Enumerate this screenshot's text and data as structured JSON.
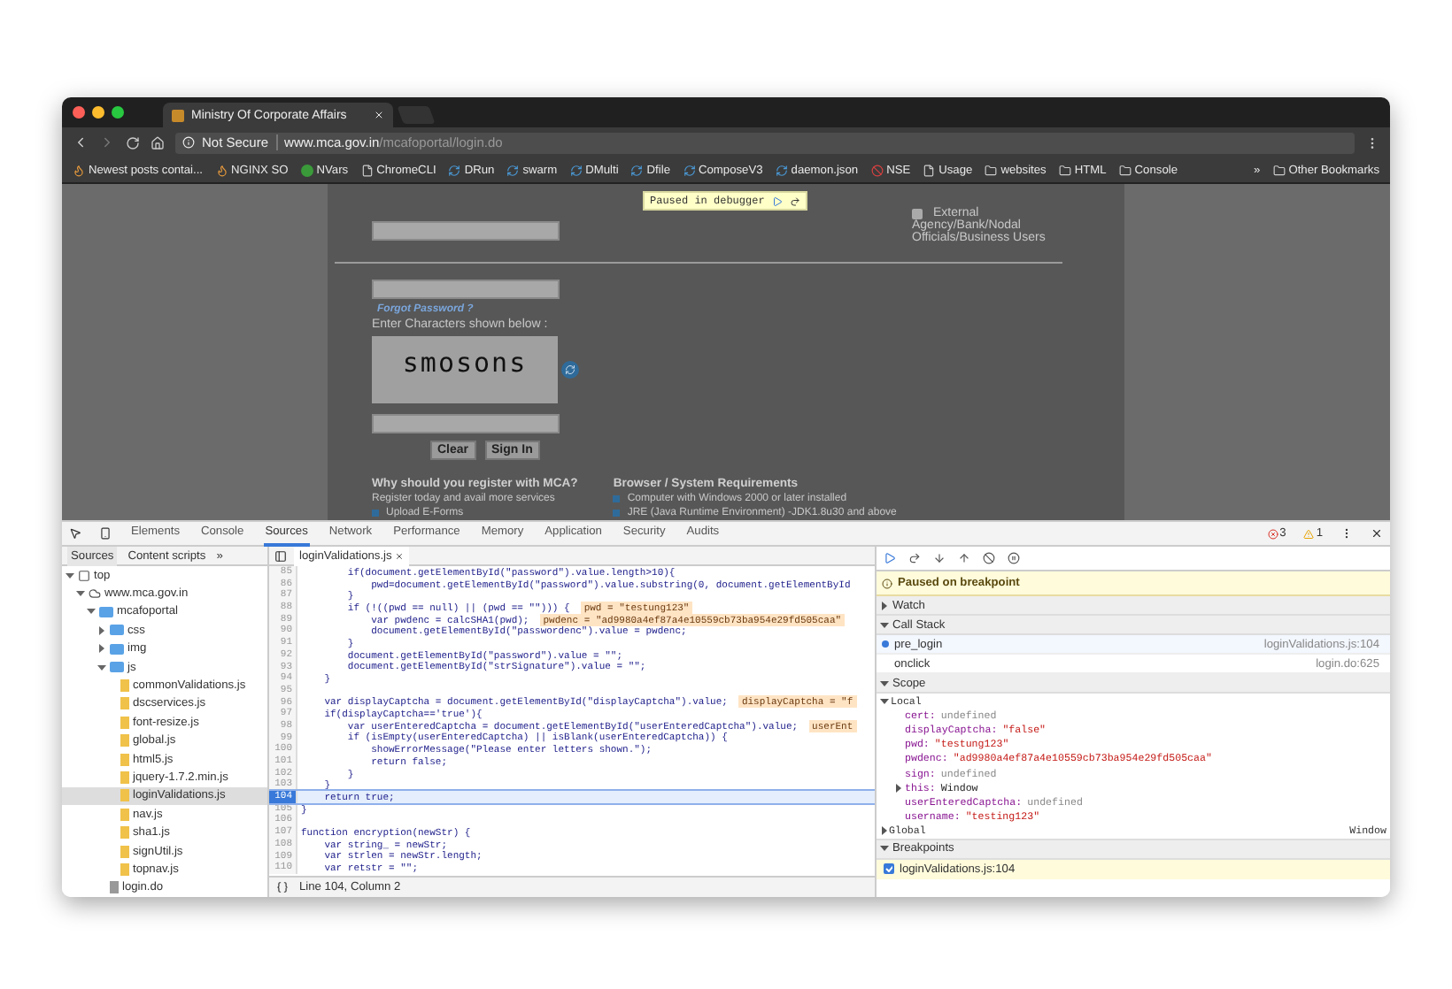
{
  "browser": {
    "tabs": [
      {
        "title": "Ministry Of Corporate Affairs",
        "selected": true
      }
    ],
    "address": {
      "security": "Not Secure",
      "host": "www.mca.gov.in",
      "path": "/mcafoportal/login.do"
    },
    "bookmarks": [
      {
        "label": "Newest posts contai...",
        "kind": "flame"
      },
      {
        "label": "NGINX SO",
        "kind": "flame"
      },
      {
        "label": "NVars",
        "kind": "dot"
      },
      {
        "label": "ChromeCLI",
        "kind": "page"
      },
      {
        "label": "DRun",
        "kind": "swirl"
      },
      {
        "label": "swarm",
        "kind": "swirl"
      },
      {
        "label": "DMulti",
        "kind": "swirl"
      },
      {
        "label": "Dfile",
        "kind": "swirl"
      },
      {
        "label": "ComposeV3",
        "kind": "swirl"
      },
      {
        "label": "daemon.json",
        "kind": "swirl"
      },
      {
        "label": "NSE",
        "kind": "badge"
      },
      {
        "label": "Usage",
        "kind": "page"
      },
      {
        "label": "websites",
        "kind": "folder"
      },
      {
        "label": "HTML",
        "kind": "folder"
      },
      {
        "label": "Console",
        "kind": "folder"
      }
    ],
    "overflow": "»",
    "other_bookmarks": "Other Bookmarks"
  },
  "page": {
    "paused_banner": "Paused in debugger",
    "external": {
      "label": "External",
      "checked": false,
      "description": "Agency/Bank/Nodal Officials/Business Users"
    },
    "forgot_link": "Forgot Password ?",
    "captcha_prompt": "Enter Characters shown below :",
    "captcha_text": "smosons",
    "buttons": [
      "Clear",
      "Sign In"
    ],
    "why": {
      "heading": "Why should you register with MCA?",
      "text": "Register today and avail more services",
      "items": [
        "Upload E-Forms"
      ]
    },
    "requirements": {
      "heading": "Browser / System Requirements",
      "items": [
        "Computer with Windows 2000 or later installed",
        "JRE (Java Runtime Environment) -JDK1.8u30 and above"
      ]
    }
  },
  "devtools": {
    "tabs": [
      {
        "label": "Elements",
        "selected": false
      },
      {
        "label": "Console",
        "selected": false
      },
      {
        "label": "Sources",
        "selected": true
      },
      {
        "label": "Network",
        "selected": false
      },
      {
        "label": "Performance",
        "selected": false
      },
      {
        "label": "Memory",
        "selected": false
      },
      {
        "label": "Application",
        "selected": false
      },
      {
        "label": "Security",
        "selected": false
      },
      {
        "label": "Audits",
        "selected": false
      }
    ],
    "errors": "3",
    "warnings": "1",
    "navigator": {
      "tabs": [
        {
          "label": "Sources",
          "selected": true
        },
        {
          "label": "Content scripts",
          "selected": false
        }
      ],
      "more": "»",
      "tree": [
        {
          "label": "top",
          "kind": "frame",
          "expanded": true,
          "selected": false,
          "children": [
            {
              "label": "www.mca.gov.in",
              "kind": "domain",
              "expanded": true,
              "selected": false,
              "children": [
                {
                  "label": "mcafoportal",
                  "kind": "folder",
                  "expanded": true,
                  "selected": false,
                  "children": [
                    {
                      "label": "css",
                      "kind": "folder",
                      "expanded": false,
                      "selected": false
                    },
                    {
                      "label": "img",
                      "kind": "folder",
                      "expanded": false,
                      "selected": false
                    },
                    {
                      "label": "js",
                      "kind": "folder",
                      "expanded": true,
                      "selected": false,
                      "children": [
                        {
                          "label": "commonValidations.js",
                          "kind": "script",
                          "selected": false
                        },
                        {
                          "label": "dscservices.js",
                          "kind": "script",
                          "selected": false
                        },
                        {
                          "label": "font-resize.js",
                          "kind": "script",
                          "selected": false
                        },
                        {
                          "label": "global.js",
                          "kind": "script",
                          "selected": false
                        },
                        {
                          "label": "html5.js",
                          "kind": "script",
                          "selected": false
                        },
                        {
                          "label": "jquery-1.7.2.min.js",
                          "kind": "script",
                          "selected": false
                        },
                        {
                          "label": "loginValidations.js",
                          "kind": "script",
                          "selected": true
                        },
                        {
                          "label": "nav.js",
                          "kind": "script",
                          "selected": false
                        },
                        {
                          "label": "sha1.js",
                          "kind": "script",
                          "selected": false
                        },
                        {
                          "label": "signUtil.js",
                          "kind": "script",
                          "selected": false
                        },
                        {
                          "label": "topnav.js",
                          "kind": "script",
                          "selected": false
                        }
                      ]
                    },
                    {
                      "label": "login.do",
                      "kind": "page",
                      "selected": false
                    }
                  ]
                }
              ]
            }
          ]
        }
      ]
    },
    "editor": {
      "file": "loginValidations.js",
      "status": "Line 104, Column 2",
      "lines": [
        {
          "num": "85",
          "code": "        if(document.getElementById(\"password\").value.length>10){",
          "current": false
        },
        {
          "num": "86",
          "code": "            pwd=document.getElementById(\"password\").value.substring(0, document.getElementById",
          "current": false
        },
        {
          "num": "87",
          "code": "        }",
          "current": false
        },
        {
          "num": "88",
          "code": "        if (!((pwd == null) || (pwd == \"\"))) {",
          "value": "pwd = \"testung123\"",
          "current": false
        },
        {
          "num": "89",
          "code": "            var pwdenc = calcSHA1(pwd);",
          "value": "pwdenc = \"ad9980a4ef87a4e10559cb73ba954e29fd505caa\"",
          "current": false
        },
        {
          "num": "90",
          "code": "            document.getElementById(\"passwordenc\").value = pwdenc;",
          "current": false
        },
        {
          "num": "91",
          "code": "        }",
          "current": false
        },
        {
          "num": "92",
          "code": "        document.getElementById(\"password\").value = \"\";",
          "current": false
        },
        {
          "num": "93",
          "code": "        document.getElementById(\"strSignature\").value = \"\";",
          "current": false
        },
        {
          "num": "94",
          "code": "    }",
          "current": false
        },
        {
          "num": "95",
          "current": false
        },
        {
          "num": "96",
          "code": "    var displayCaptcha = document.getElementById(\"displayCaptcha\").value;",
          "value": "displayCaptcha = \"f",
          "current": false
        },
        {
          "num": "97",
          "code": "    if(displayCaptcha=='true'){",
          "current": false
        },
        {
          "num": "98",
          "code": "        var userEnteredCaptcha = document.getElementById(\"userEnteredCaptcha\").value;",
          "value": "userEnt",
          "current": false
        },
        {
          "num": "99",
          "code": "        if (isEmpty(userEnteredCaptcha) || isBlank(userEnteredCaptcha)) {",
          "current": false
        },
        {
          "num": "100",
          "code": "            showErrorMessage(\"Please enter letters shown.\");",
          "current": false
        },
        {
          "num": "101",
          "code": "            return false;",
          "current": false
        },
        {
          "num": "102",
          "code": "        }",
          "current": false
        },
        {
          "num": "103",
          "code": "    }",
          "current": false
        },
        {
          "num": "104",
          "code": "    return true;",
          "current": true
        },
        {
          "num": "105",
          "code": "}",
          "current": false
        },
        {
          "num": "106",
          "current": false
        },
        {
          "num": "107",
          "code": "function encryption(newStr) {",
          "current": false
        },
        {
          "num": "108",
          "code": "    var string_ = newStr;",
          "current": false
        },
        {
          "num": "109",
          "code": "    var strlen = newStr.length;",
          "current": false
        },
        {
          "num": "110",
          "code": "    var retstr = \"\";",
          "current": false
        }
      ]
    },
    "debugger": {
      "paused": "Paused on breakpoint",
      "sections": [
        {
          "title": "Watch",
          "expanded": false
        },
        {
          "title": "Call Stack",
          "expanded": true
        },
        {
          "title": "Scope",
          "expanded": true
        },
        {
          "title": "Breakpoints",
          "expanded": true
        }
      ],
      "call_stack": [
        {
          "name": "pre_login",
          "location": "loginValidations.js:104",
          "selected": true
        },
        {
          "name": "onclick",
          "location": "login.do:625",
          "selected": false
        }
      ],
      "scope": {
        "local": {
          "label": "Local",
          "expanded": true
        },
        "vars": [
          {
            "name": "cert:",
            "value": "undefined",
            "kind": "undefined",
            "expandable": false
          },
          {
            "name": "displayCaptcha:",
            "value": "\"false\"",
            "kind": "string",
            "expandable": false
          },
          {
            "name": "pwd:",
            "value": "\"testung123\"",
            "kind": "string",
            "expandable": false
          },
          {
            "name": "pwdenc:",
            "value": "\"ad9980a4ef87a4e10559cb73ba954e29fd505caa\"",
            "kind": "string",
            "expandable": false
          },
          {
            "name": "sign:",
            "value": "undefined",
            "kind": "undefined",
            "expandable": false
          },
          {
            "name": "this:",
            "value": "Window",
            "kind": "object",
            "expandable": true
          },
          {
            "name": "userEnteredCaptcha:",
            "value": "undefined",
            "kind": "undefined",
            "expandable": false
          },
          {
            "name": "username:",
            "value": "\"testing123\"",
            "kind": "string",
            "expandable": false
          }
        ],
        "global": {
          "label": "Global",
          "value": "Window",
          "expanded": false
        }
      },
      "breakpoints": [
        {
          "label": "loginValidations.js:104",
          "checked": true
        }
      ]
    }
  }
}
